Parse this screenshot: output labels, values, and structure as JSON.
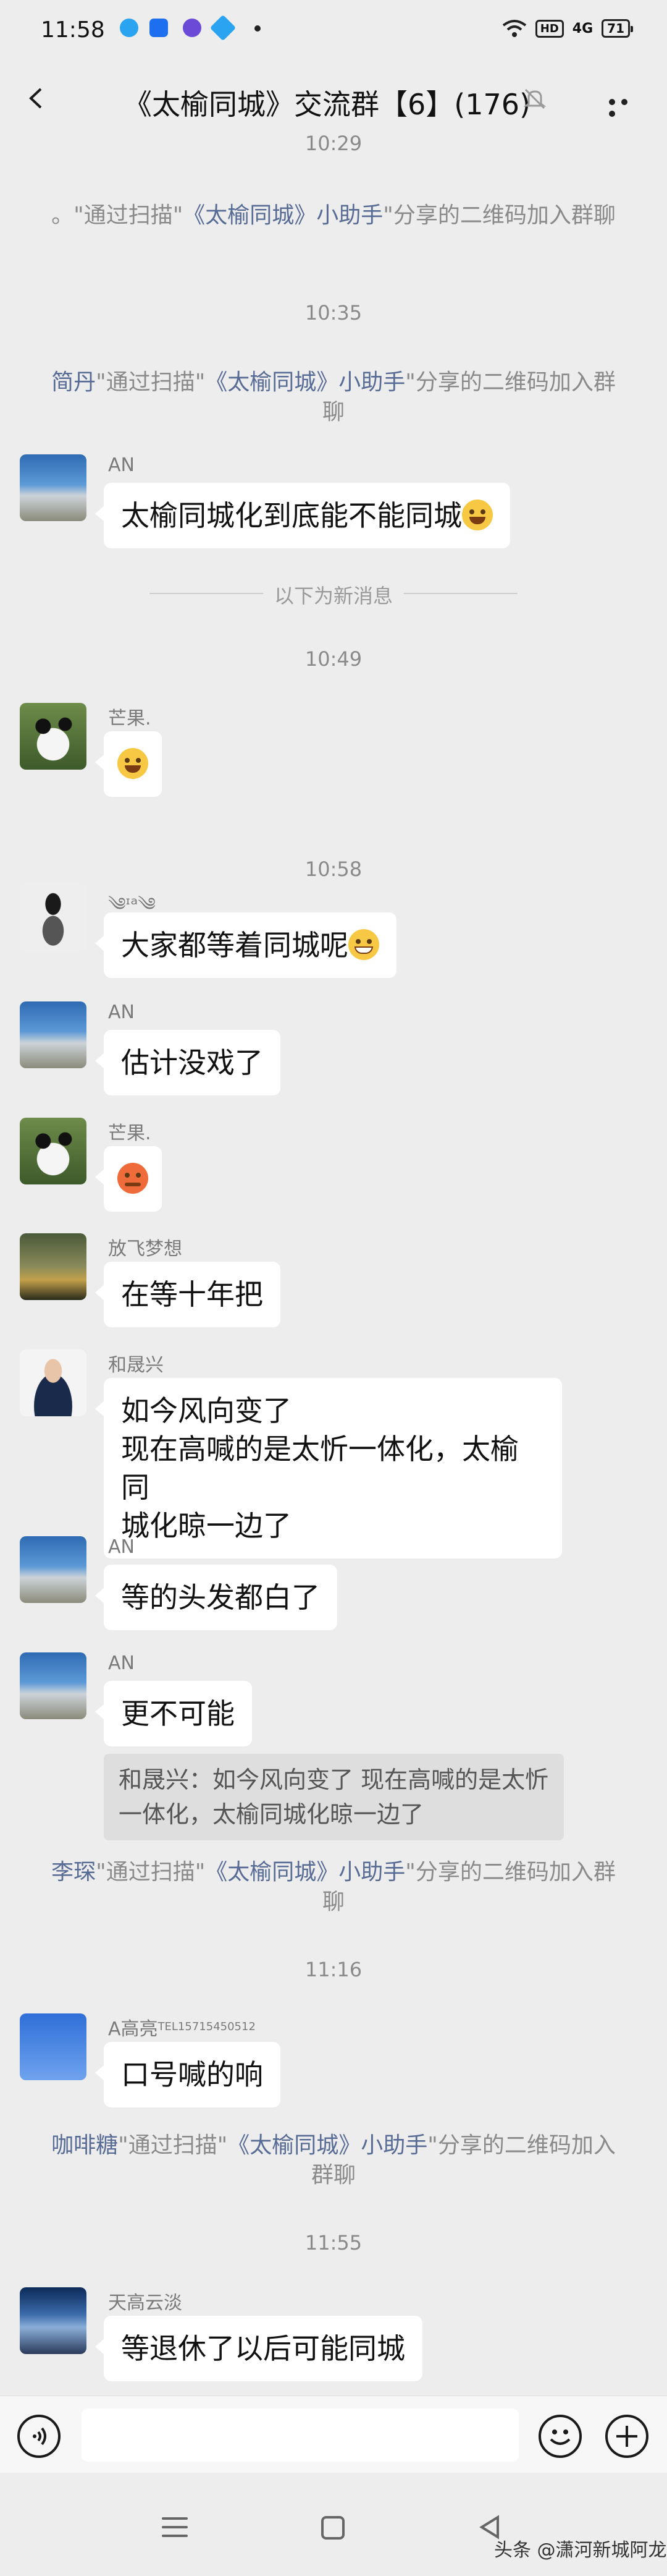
{
  "status": {
    "time": "11:58",
    "hd": "HD",
    "network": "4G",
    "battery": "71"
  },
  "header": {
    "title": "《太榆同城》交流群【6】(176)"
  },
  "timestamps": [
    "10:29",
    "10:35",
    "10:49",
    "10:58",
    "11:16",
    "11:55"
  ],
  "system_msgs": [
    {
      "name": "。",
      "pre": "\"通过扫描\"",
      "link": "《太榆同城》小助手",
      "post": "\"分享的二维码加入群聊"
    },
    {
      "name": "简丹",
      "pre": "\"通过扫描\"",
      "link": "《太榆同城》小助手",
      "post": "\"分享的二维码加入群聊"
    },
    {
      "name": "李琛",
      "pre": "\"通过扫描\"",
      "link": "《太榆同城》小助手",
      "post": "\"分享的二维码加入群聊"
    },
    {
      "name": "咖啡糖",
      "pre": "\"通过扫描\"",
      "link": "《太榆同城》小助手",
      "post": "\"分享的二维码加入群聊"
    }
  ],
  "new_msg_divider": "以下为新消息",
  "messages": [
    {
      "sender": "AN",
      "text": "太榆同城化到底能不能同城"
    },
    {
      "sender": "芒果.",
      "text": ""
    },
    {
      "sender": "༄ᶦᵃ༄",
      "text": "大家都等着同城呢"
    },
    {
      "sender": "AN",
      "text": "估计没戏了"
    },
    {
      "sender": "芒果.",
      "text": ""
    },
    {
      "sender": "放飞梦想",
      "text": "在等十年把"
    },
    {
      "sender": "和晟兴",
      "line1": "如今风向变了",
      "line2": "现在高喊的是太忻一体化，太榆同",
      "line3": "城化晾一边了"
    },
    {
      "sender": "AN",
      "text": "等的头发都白了"
    },
    {
      "sender": "AN",
      "text": "更不可能",
      "quote": "和晟兴：如今风向变了 现在高喊的是太忻一体化，太榆同城化晾一边了"
    },
    {
      "sender": "A高亮",
      "sender_tag": "TEL15715450512",
      "text": "口号喊的响"
    },
    {
      "sender": "天高云淡",
      "text": "等退休了以后可能同城"
    }
  ],
  "watermark": "头条 @潇河新城阿龙",
  "icons": {
    "back": "chevron-left-icon",
    "mute": "bell-off-icon",
    "more": "more-dots-icon",
    "voice": "voice-icon",
    "emoji": "emoji-icon",
    "plus": "plus-icon"
  }
}
